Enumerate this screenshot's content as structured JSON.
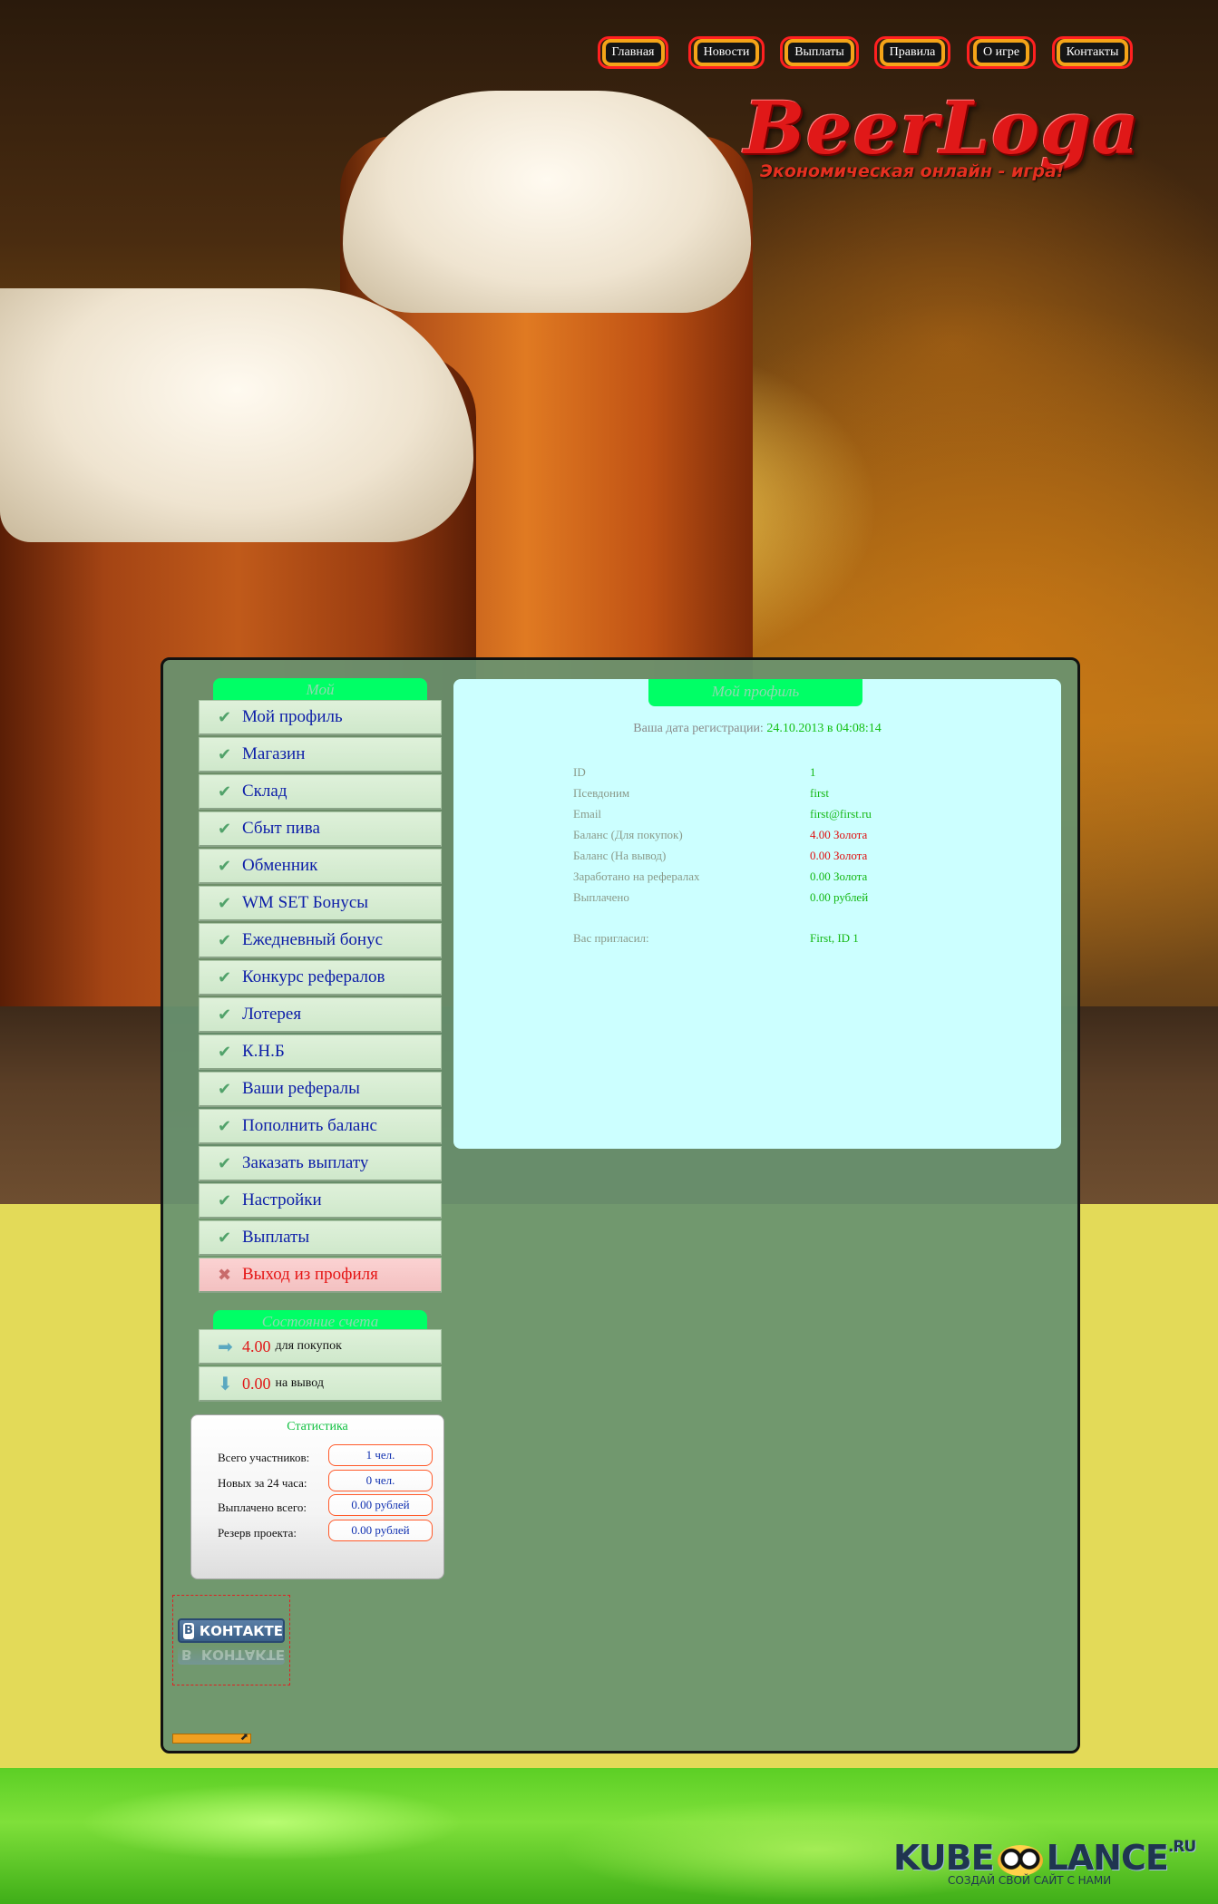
{
  "nav": [
    "Главная",
    "Новости",
    "Выплаты",
    "Правила",
    "О игре",
    "Контакты"
  ],
  "logo": {
    "title": "BeerLoga",
    "subtitle": "Экономическая онлайн - игра!"
  },
  "sidebar": {
    "menu_header": "Мой",
    "menu": [
      "Мой профиль",
      "Магазин",
      "Склад",
      "Сбыт пива",
      "Обменник",
      "WM SET Бонусы",
      "Ежедневный бонус",
      "Конкурс рефералов",
      "Лотерея",
      "К.Н.Б",
      "Ваши рефералы",
      "Пополнить баланс",
      "Заказать выплату",
      "Настройки",
      "Выплаты"
    ],
    "logout": "Выход из профиля",
    "account_header": "Состояние счета",
    "account": [
      {
        "value": "4.00",
        "label": "для покупок"
      },
      {
        "value": "0.00",
        "label": "на вывод"
      }
    ],
    "stats": {
      "title": "Статистика",
      "rows": [
        {
          "label": "Всего участников:",
          "value": "1 чел."
        },
        {
          "label": "Новых за 24 часа:",
          "value": "0 чел."
        },
        {
          "label": "Выплачено всего:",
          "value": "0.00 рублей"
        },
        {
          "label": "Резерв проекта:",
          "value": "0.00 рублей"
        }
      ]
    },
    "vk_label": "КОНТАКТЕ",
    "vk_letter": "В"
  },
  "profile": {
    "title": "Мой профиль",
    "reg_label": "Ваша дата регистрации:",
    "reg_date": "24.10.2013 в 04:08:14",
    "rows": [
      {
        "label": "ID",
        "value": "1"
      },
      {
        "label": "Псевдоним",
        "value": "first"
      },
      {
        "label": "Email",
        "value": "first@first.ru"
      },
      {
        "label": "Баланс (Для покупок)",
        "value": "4.00 Золота"
      },
      {
        "label": "Баланс (На вывод)",
        "value": "0.00 Золота"
      },
      {
        "label": "Заработано на рефералах",
        "value": "0.00 Золота"
      },
      {
        "label": "Выплачено",
        "value": "0.00 рублей"
      }
    ],
    "invited_label": "Вас пригласил:",
    "invited_value": "First, ID 1"
  },
  "footer": {
    "brand_left": "KUBE",
    "brand_right": "LANCE",
    "brand_tld": ".RU",
    "tagline": "СОЗДАЙ СВОЙ САЙТ С НАМИ"
  },
  "colors": {
    "accent_green": "#00ff66",
    "menu_text": "#0d1ea8",
    "value_red": "#e01818"
  }
}
